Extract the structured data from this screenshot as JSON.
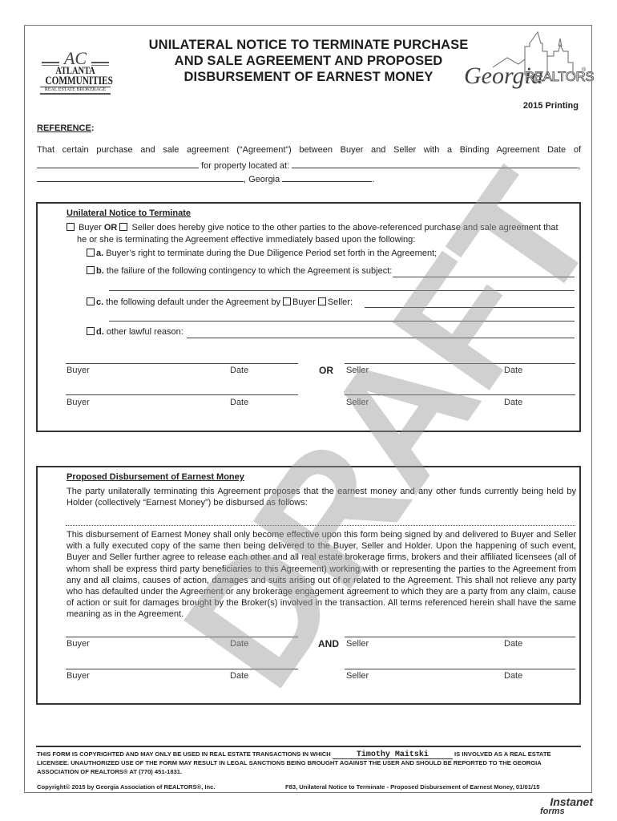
{
  "header": {
    "title_lines": [
      "UNILATERAL NOTICE TO TERMINATE PURCHASE",
      "AND SALE AGREEMENT AND PROPOSED",
      "DISBURSEMENT OF EARNEST MONEY"
    ],
    "printing": "2015 Printing",
    "left_logo": {
      "monogram": "AC",
      "line1": "ATLANTA",
      "line2": "COMMUNITIES",
      "line3": "REAL ESTATE BROKERAGE"
    },
    "right_logo": {
      "script": "Georgia",
      "word": "REALTORS",
      "mark": "®"
    }
  },
  "reference": {
    "label": "REFERENCE",
    "colon": ":",
    "line1": "That certain purchase and sale agreement (“Agreement”) between Buyer and Seller with a Binding Agreement Date of",
    "property_label": "for property located at:",
    "comma": ",",
    "georgia_label": ", Georgia",
    "period": ".",
    "binding_date_value": "",
    "property_address_value": "",
    "city_value": "",
    "zip_value": ""
  },
  "notice": {
    "title": "Unilateral Notice to Terminate",
    "buyer_label": "Buyer",
    "or_label": "OR",
    "seller_text": "Seller does hereby give notice to the other parties to the above-referenced purchase and sale agreement that",
    "seller_text_2": "he or she is terminating the Agreement effective immediately based upon the following:",
    "options": [
      {
        "letter": "a.",
        "text": "Buyer’s right to terminate during the Due Diligence Period set forth in the Agreement;"
      },
      {
        "letter": "b.",
        "text": "the failure of the following contingency to which the Agreement is subject:"
      },
      {
        "letter": "c.",
        "text": "the following default under the Agreement by",
        "buyer": "Buyer",
        "seller": "Seller:"
      },
      {
        "letter": "d.",
        "text": "other lawful reason:"
      }
    ],
    "signatures": {
      "row1": [
        "Buyer",
        "Date",
        "OR",
        "Seller",
        "Date"
      ],
      "row2": [
        "Buyer",
        "Date",
        "Seller",
        "Date"
      ]
    }
  },
  "disbursement": {
    "title": "Proposed Disbursement of Earnest Money",
    "intro": "The party unilaterally terminating this Agreement proposes that the earnest money and any other funds currently being held by Holder (collectively “Earnest Money”) be disbursed as follows:",
    "body": "This disbursement of Earnest Money shall only become effective upon this form being signed by and delivered to Buyer and Seller with a fully executed copy of the same then being delivered to the Buyer, Seller and Holder. Upon the happening of such event, Buyer and Seller further agree to release each other and all real estate brokerage firms, brokers and their affiliated licensees (all of whom shall be express third party beneficiaries to this Agreement) working with or representing the parties to the Agreement from any and all claims, causes of action, damages and suits arising out of or related to the Agreement. This shall not relieve any party who has defaulted under the Agreement or any brokerage engagement agreement to which they are a party from any claim, cause of action or suit for damages brought by the Broker(s) involved in the transaction.  All terms referenced herein shall have the same meaning as in the Agreement.",
    "signatures": {
      "row1": [
        "Buyer",
        "Date",
        "AND",
        "Seller",
        "Date"
      ],
      "row2": [
        "Buyer",
        "Date",
        "Seller",
        "Date"
      ]
    }
  },
  "footer": {
    "notice_part1": "THIS FORM IS COPYRIGHTED AND MAY ONLY BE USED IN REAL ESTATE TRANSACTIONS IN WHICH",
    "licensee": "Timothy Maitski",
    "notice_part2": "IS INVOLVED AS A REAL ESTATE LICENSEE.  UNAUTHORIZED USE OF THE FORM MAY RESULT IN LEGAL SANCTIONS BEING BROUGHT AGAINST THE USER AND SHOULD BE REPORTED TO THE GEORGIA ASSOCIATION OF REALTORS® AT (770) 451-1831.",
    "copyright": "Copyright© 2015 by Georgia Association of REALTORS®, Inc.",
    "form_id": "F83, Unilateral Notice to Terminate - Proposed Disbursement of Earnest Money, 01/01/15",
    "instanet": {
      "line1": "Instanet",
      "line2": "forms"
    }
  },
  "watermark": "DRAFT"
}
